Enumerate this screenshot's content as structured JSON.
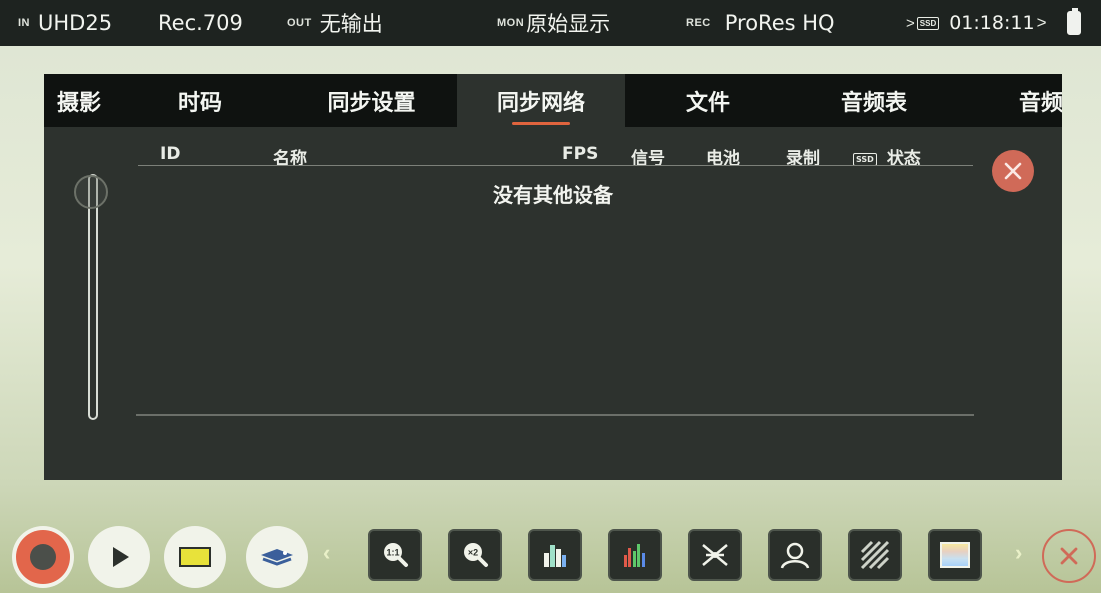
{
  "status_bar": {
    "in_tag": "IN",
    "in_value": "UHD25",
    "colorspace": "Rec.709",
    "out_tag": "OUT",
    "out_value": "无输出",
    "mon_tag": "MON",
    "mon_value": "原始显示",
    "rec_tag": "REC",
    "rec_value": "ProRes HQ",
    "media_arrow": ">",
    "ssd_label": "SSD",
    "timecode": "01:18:11",
    "timecode_arrow": ">"
  },
  "tabs": [
    {
      "label": "摄影"
    },
    {
      "label": "时码"
    },
    {
      "label": "同步设置"
    },
    {
      "label": "同步网络",
      "active": true
    },
    {
      "label": "文件"
    },
    {
      "label": "音频表"
    },
    {
      "label": "音频"
    }
  ],
  "table": {
    "columns": {
      "id": "ID",
      "name": "名称",
      "fps": "FPS",
      "signal": "信号",
      "battery": "电池",
      "record": "录制",
      "ssd": "SSD",
      "status": "状态"
    },
    "empty_message": "没有其他设备"
  },
  "toolbar": {
    "prev_arrow": "‹",
    "next_arrow": "›",
    "tools": [
      "zoom-1to1-icon",
      "zoom-2x-icon",
      "waveform-icon",
      "histogram-icon",
      "network-icon",
      "focus-peaking-icon",
      "zebra-icon",
      "color-bars-icon"
    ]
  },
  "colors": {
    "accent": "#e0643e",
    "close_button": "#d06a58",
    "panel": "#2d322e",
    "tabbar": "#0f1210"
  }
}
